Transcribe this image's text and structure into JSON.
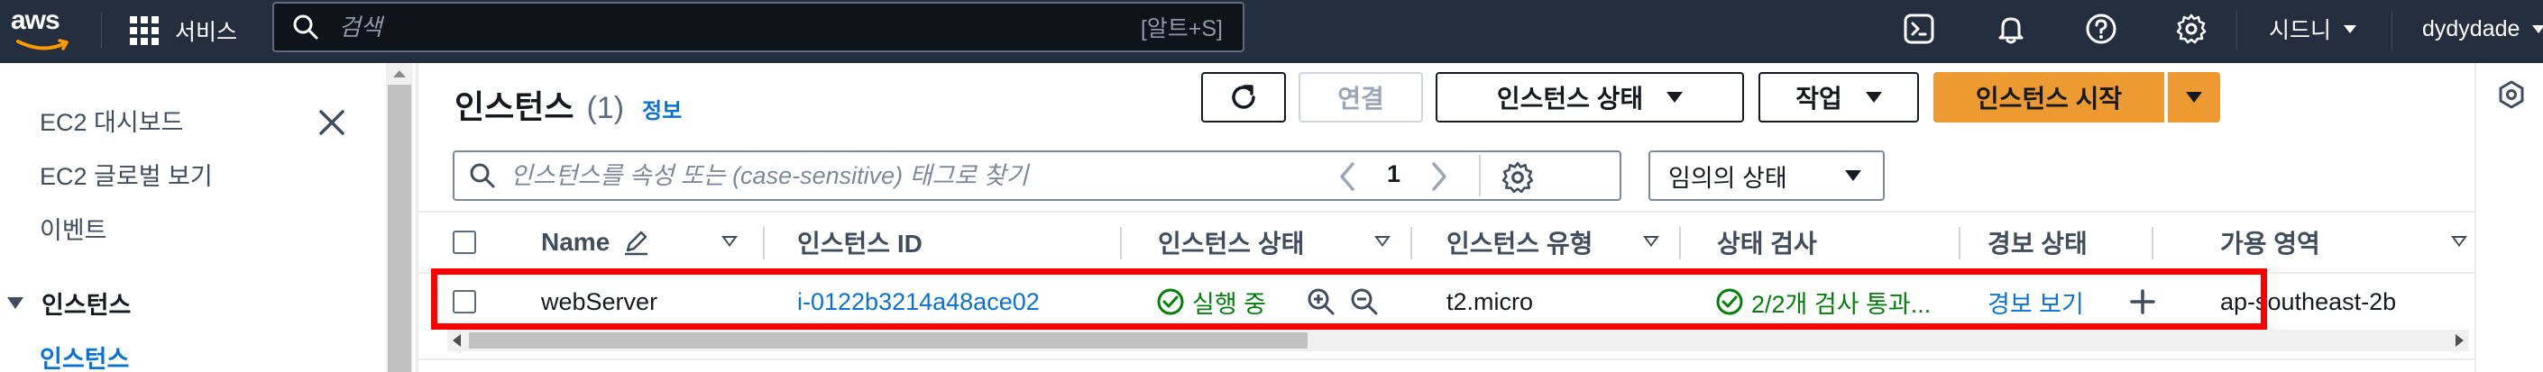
{
  "topnav": {
    "logo": "aws",
    "services_label": "서비스",
    "search_placeholder": "검색",
    "search_shortcut": "[알트+S]",
    "icons": [
      "cloudshell-icon",
      "bell-icon",
      "help-icon",
      "gear-icon"
    ],
    "region_label": "시드니",
    "account_label": "dydydade"
  },
  "sidebar": {
    "items": [
      {
        "label": "EC2 대시보드"
      },
      {
        "label": "EC2 글로벌 보기"
      },
      {
        "label": "이벤트"
      }
    ],
    "section_label": "인스턴스",
    "active_item": "인스턴스"
  },
  "main": {
    "title": "인스턴스",
    "count": "(1)",
    "info_link": "정보",
    "buttons": {
      "connect": "연결",
      "instance_state": "인스턴스 상태",
      "actions": "작업",
      "launch": "인스턴스 시작"
    },
    "filter_placeholder": "인스턴스를 속성 또는 (case-sensitive) 태그로 찾기",
    "state_filter": "임의의 상태",
    "page_number": "1"
  },
  "table": {
    "columns": [
      "Name",
      "인스턴스 ID",
      "인스턴스 상태",
      "인스턴스 유형",
      "상태 검사",
      "경보 상태",
      "가용 영역"
    ],
    "rows": [
      {
        "name": "webServer",
        "instance_id": "i-0122b3214a48ace02",
        "state": "실행 중",
        "type": "t2.micro",
        "status_check": "2/2개 검사 통과...",
        "alarm": "경보 보기",
        "az": "ap-southeast-2b"
      }
    ]
  },
  "colors": {
    "nav_bg": "#232f3e",
    "primary": "#ec9a31",
    "link": "#0972d3",
    "success": "#037f0c",
    "highlight": "#ff0000"
  }
}
